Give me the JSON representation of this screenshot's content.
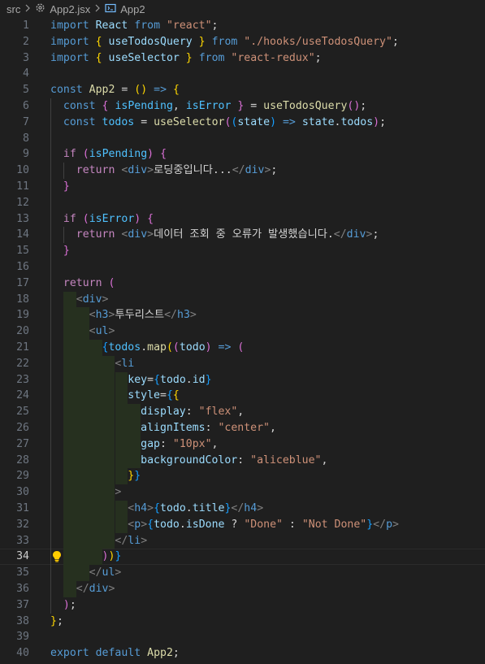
{
  "breadcrumb": {
    "folder": "src",
    "file": "App2.jsx",
    "symbol": "App2"
  },
  "editor": {
    "current_line": 34,
    "lines": [
      {
        "n": "1"
      },
      {
        "n": "2"
      },
      {
        "n": "3"
      },
      {
        "n": "4"
      },
      {
        "n": "5"
      },
      {
        "n": "6"
      },
      {
        "n": "7"
      },
      {
        "n": "8"
      },
      {
        "n": "9"
      },
      {
        "n": "10"
      },
      {
        "n": "11"
      },
      {
        "n": "12"
      },
      {
        "n": "13"
      },
      {
        "n": "14"
      },
      {
        "n": "15"
      },
      {
        "n": "16"
      },
      {
        "n": "17"
      },
      {
        "n": "18"
      },
      {
        "n": "19"
      },
      {
        "n": "20"
      },
      {
        "n": "21"
      },
      {
        "n": "22"
      },
      {
        "n": "23"
      },
      {
        "n": "24"
      },
      {
        "n": "25"
      },
      {
        "n": "26"
      },
      {
        "n": "27"
      },
      {
        "n": "28"
      },
      {
        "n": "29"
      },
      {
        "n": "30"
      },
      {
        "n": "31"
      },
      {
        "n": "32"
      },
      {
        "n": "33"
      },
      {
        "n": "34"
      },
      {
        "n": "35"
      },
      {
        "n": "36"
      },
      {
        "n": "37"
      },
      {
        "n": "38"
      },
      {
        "n": "39"
      },
      {
        "n": "40"
      }
    ],
    "code": [
      [
        [
          "b",
          "import"
        ],
        [
          "w",
          " "
        ],
        [
          "v",
          "React"
        ],
        [
          "w",
          " "
        ],
        [
          "b",
          "from"
        ],
        [
          "w",
          " "
        ],
        [
          "s",
          "\"react\""
        ],
        [
          "d",
          ";"
        ]
      ],
      [
        [
          "b",
          "import"
        ],
        [
          "w",
          " "
        ],
        [
          "p1",
          "{"
        ],
        [
          "w",
          " "
        ],
        [
          "v",
          "useTodosQuery"
        ],
        [
          "w",
          " "
        ],
        [
          "p1",
          "}"
        ],
        [
          "w",
          " "
        ],
        [
          "b",
          "from"
        ],
        [
          "w",
          " "
        ],
        [
          "s",
          "\"./hooks/useTodosQuery\""
        ],
        [
          "d",
          ";"
        ]
      ],
      [
        [
          "b",
          "import"
        ],
        [
          "w",
          " "
        ],
        [
          "p1",
          "{"
        ],
        [
          "w",
          " "
        ],
        [
          "v",
          "useSelector"
        ],
        [
          "w",
          " "
        ],
        [
          "p1",
          "}"
        ],
        [
          "w",
          " "
        ],
        [
          "b",
          "from"
        ],
        [
          "w",
          " "
        ],
        [
          "s",
          "\"react-redux\""
        ],
        [
          "d",
          ";"
        ]
      ],
      [],
      [
        [
          "b",
          "const"
        ],
        [
          "w",
          " "
        ],
        [
          "f",
          "App2"
        ],
        [
          "w",
          " "
        ],
        [
          "d",
          "="
        ],
        [
          "w",
          " "
        ],
        [
          "p1",
          "()"
        ],
        [
          "w",
          " "
        ],
        [
          "b",
          "=>"
        ],
        [
          "w",
          " "
        ],
        [
          "p1",
          "{"
        ]
      ],
      [
        [
          "w",
          "  "
        ],
        [
          "b",
          "const"
        ],
        [
          "w",
          " "
        ],
        [
          "p2",
          "{"
        ],
        [
          "w",
          " "
        ],
        [
          "c",
          "isPending"
        ],
        [
          "d",
          ","
        ],
        [
          "w",
          " "
        ],
        [
          "c",
          "isError"
        ],
        [
          "w",
          " "
        ],
        [
          "p2",
          "}"
        ],
        [
          "w",
          " "
        ],
        [
          "d",
          "="
        ],
        [
          "w",
          " "
        ],
        [
          "f",
          "useTodosQuery"
        ],
        [
          "p2",
          "()"
        ],
        [
          "d",
          ";"
        ]
      ],
      [
        [
          "w",
          "  "
        ],
        [
          "b",
          "const"
        ],
        [
          "w",
          " "
        ],
        [
          "c",
          "todos"
        ],
        [
          "w",
          " "
        ],
        [
          "d",
          "="
        ],
        [
          "w",
          " "
        ],
        [
          "f",
          "useSelector"
        ],
        [
          "p2",
          "("
        ],
        [
          "p3",
          "("
        ],
        [
          "v",
          "state"
        ],
        [
          "p3",
          ")"
        ],
        [
          "w",
          " "
        ],
        [
          "b",
          "=>"
        ],
        [
          "w",
          " "
        ],
        [
          "v",
          "state"
        ],
        [
          "d",
          "."
        ],
        [
          "v",
          "todos"
        ],
        [
          "p2",
          ")"
        ],
        [
          "d",
          ";"
        ]
      ],
      [],
      [
        [
          "w",
          "  "
        ],
        [
          "k",
          "if"
        ],
        [
          "w",
          " "
        ],
        [
          "p2",
          "("
        ],
        [
          "c",
          "isPending"
        ],
        [
          "p2",
          ")"
        ],
        [
          "w",
          " "
        ],
        [
          "p2",
          "{"
        ]
      ],
      [
        [
          "w",
          "    "
        ],
        [
          "k",
          "return"
        ],
        [
          "w",
          " "
        ],
        [
          "g",
          "<"
        ],
        [
          "t",
          "div"
        ],
        [
          "g",
          ">"
        ],
        [
          "d",
          "로딩중입니다..."
        ],
        [
          "g",
          "</"
        ],
        [
          "t",
          "div"
        ],
        [
          "g",
          ">"
        ],
        [
          "d",
          ";"
        ]
      ],
      [
        [
          "w",
          "  "
        ],
        [
          "p2",
          "}"
        ]
      ],
      [],
      [
        [
          "w",
          "  "
        ],
        [
          "k",
          "if"
        ],
        [
          "w",
          " "
        ],
        [
          "p2",
          "("
        ],
        [
          "c",
          "isError"
        ],
        [
          "p2",
          ")"
        ],
        [
          "w",
          " "
        ],
        [
          "p2",
          "{"
        ]
      ],
      [
        [
          "w",
          "    "
        ],
        [
          "k",
          "return"
        ],
        [
          "w",
          " "
        ],
        [
          "g",
          "<"
        ],
        [
          "t",
          "div"
        ],
        [
          "g",
          ">"
        ],
        [
          "d",
          "데이터 조회 중 오류가 발생했습니다."
        ],
        [
          "g",
          "</"
        ],
        [
          "t",
          "div"
        ],
        [
          "g",
          ">"
        ],
        [
          "d",
          ";"
        ]
      ],
      [
        [
          "w",
          "  "
        ],
        [
          "p2",
          "}"
        ]
      ],
      [],
      [
        [
          "w",
          "  "
        ],
        [
          "k",
          "return"
        ],
        [
          "w",
          " "
        ],
        [
          "p2",
          "("
        ]
      ],
      [
        [
          "w",
          "    "
        ],
        [
          "g",
          "<"
        ],
        [
          "t",
          "div"
        ],
        [
          "g",
          ">"
        ]
      ],
      [
        [
          "w",
          "      "
        ],
        [
          "g",
          "<"
        ],
        [
          "t",
          "h3"
        ],
        [
          "g",
          ">"
        ],
        [
          "d",
          "투두리스트"
        ],
        [
          "g",
          "</"
        ],
        [
          "t",
          "h3"
        ],
        [
          "g",
          ">"
        ]
      ],
      [
        [
          "w",
          "      "
        ],
        [
          "g",
          "<"
        ],
        [
          "t",
          "ul"
        ],
        [
          "g",
          ">"
        ]
      ],
      [
        [
          "w",
          "        "
        ],
        [
          "p3",
          "{"
        ],
        [
          "c",
          "todos"
        ],
        [
          "d",
          "."
        ],
        [
          "f",
          "map"
        ],
        [
          "p1",
          "("
        ],
        [
          "p2",
          "("
        ],
        [
          "v",
          "todo"
        ],
        [
          "p2",
          ")"
        ],
        [
          "w",
          " "
        ],
        [
          "b",
          "=>"
        ],
        [
          "w",
          " "
        ],
        [
          "p2",
          "("
        ]
      ],
      [
        [
          "w",
          "          "
        ],
        [
          "g",
          "<"
        ],
        [
          "t",
          "li"
        ]
      ],
      [
        [
          "w",
          "            "
        ],
        [
          "v",
          "key"
        ],
        [
          "d",
          "="
        ],
        [
          "p3",
          "{"
        ],
        [
          "v",
          "todo"
        ],
        [
          "d",
          "."
        ],
        [
          "v",
          "id"
        ],
        [
          "p3",
          "}"
        ]
      ],
      [
        [
          "w",
          "            "
        ],
        [
          "v",
          "style"
        ],
        [
          "d",
          "="
        ],
        [
          "p3",
          "{"
        ],
        [
          "p1",
          "{"
        ]
      ],
      [
        [
          "w",
          "              "
        ],
        [
          "v",
          "display"
        ],
        [
          "d",
          ":"
        ],
        [
          "w",
          " "
        ],
        [
          "s",
          "\"flex\""
        ],
        [
          "d",
          ","
        ]
      ],
      [
        [
          "w",
          "              "
        ],
        [
          "v",
          "alignItems"
        ],
        [
          "d",
          ":"
        ],
        [
          "w",
          " "
        ],
        [
          "s",
          "\"center\""
        ],
        [
          "d",
          ","
        ]
      ],
      [
        [
          "w",
          "              "
        ],
        [
          "v",
          "gap"
        ],
        [
          "d",
          ":"
        ],
        [
          "w",
          " "
        ],
        [
          "s",
          "\"10px\""
        ],
        [
          "d",
          ","
        ]
      ],
      [
        [
          "w",
          "              "
        ],
        [
          "v",
          "backgroundColor"
        ],
        [
          "d",
          ":"
        ],
        [
          "w",
          " "
        ],
        [
          "s",
          "\"aliceblue\""
        ],
        [
          "d",
          ","
        ]
      ],
      [
        [
          "w",
          "            "
        ],
        [
          "p1",
          "}"
        ],
        [
          "p3",
          "}"
        ]
      ],
      [
        [
          "w",
          "          "
        ],
        [
          "g",
          ">"
        ]
      ],
      [
        [
          "w",
          "            "
        ],
        [
          "g",
          "<"
        ],
        [
          "t",
          "h4"
        ],
        [
          "g",
          ">"
        ],
        [
          "p3",
          "{"
        ],
        [
          "v",
          "todo"
        ],
        [
          "d",
          "."
        ],
        [
          "v",
          "title"
        ],
        [
          "p3",
          "}"
        ],
        [
          "g",
          "</"
        ],
        [
          "t",
          "h4"
        ],
        [
          "g",
          ">"
        ]
      ],
      [
        [
          "w",
          "            "
        ],
        [
          "g",
          "<"
        ],
        [
          "t",
          "p"
        ],
        [
          "g",
          ">"
        ],
        [
          "p3",
          "{"
        ],
        [
          "v",
          "todo"
        ],
        [
          "d",
          "."
        ],
        [
          "v",
          "isDone"
        ],
        [
          "w",
          " "
        ],
        [
          "d",
          "?"
        ],
        [
          "w",
          " "
        ],
        [
          "s",
          "\"Done\""
        ],
        [
          "w",
          " "
        ],
        [
          "d",
          ":"
        ],
        [
          "w",
          " "
        ],
        [
          "s",
          "\"Not Done\""
        ],
        [
          "p3",
          "}"
        ],
        [
          "g",
          "</"
        ],
        [
          "t",
          "p"
        ],
        [
          "g",
          ">"
        ]
      ],
      [
        [
          "w",
          "          "
        ],
        [
          "g",
          "</"
        ],
        [
          "t",
          "li"
        ],
        [
          "g",
          ">"
        ]
      ],
      [
        [
          "w",
          "        "
        ],
        [
          "p2",
          ")"
        ],
        [
          "p1",
          ")"
        ],
        [
          "p3",
          "}"
        ]
      ],
      [
        [
          "w",
          "      "
        ],
        [
          "g",
          "</"
        ],
        [
          "t",
          "ul"
        ],
        [
          "g",
          ">"
        ]
      ],
      [
        [
          "w",
          "    "
        ],
        [
          "g",
          "</"
        ],
        [
          "t",
          "div"
        ],
        [
          "g",
          ">"
        ]
      ],
      [
        [
          "w",
          "  "
        ],
        [
          "p2",
          ")"
        ],
        [
          "d",
          ";"
        ]
      ],
      [
        [
          "p1",
          "}"
        ],
        [
          "d",
          ";"
        ]
      ],
      [],
      [
        [
          "b",
          "export"
        ],
        [
          "w",
          " "
        ],
        [
          "b",
          "default"
        ],
        [
          "w",
          " "
        ],
        [
          "f",
          "App2"
        ],
        [
          "d",
          ";"
        ]
      ]
    ],
    "icons": {
      "breadcrumb_separator": "chevron-right-icon",
      "file_icon": "react-gear-icon",
      "symbol_icon": "symbol-component-icon",
      "lightbulb": "lightbulb-icon"
    },
    "colors": {
      "background": "#1f1f1f",
      "keyword": "#c586c0",
      "storage": "#569cd6",
      "string": "#ce9178",
      "function": "#dcdcaa",
      "variable": "#9cdcfe",
      "lightbulb": "#ffcc00"
    }
  }
}
